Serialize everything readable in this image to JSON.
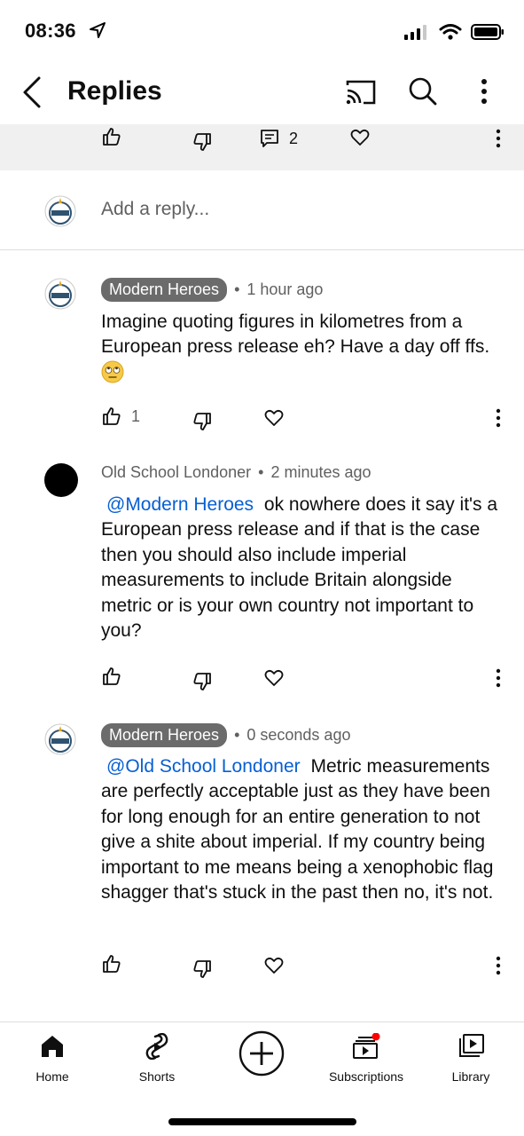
{
  "status": {
    "time": "08:36"
  },
  "header": {
    "title": "Replies"
  },
  "parent": {
    "reply_count": "2"
  },
  "add_reply": {
    "placeholder": "Add a reply..."
  },
  "comments": [
    {
      "author": "Modern Heroes",
      "time": "1 hour ago",
      "text": "Imagine quoting figures in kilometres from a European press release eh? Have a day off ffs.",
      "likes": "1"
    },
    {
      "author": "Old School Londoner",
      "time": "2 minutes ago",
      "mention": "@Modern Heroes",
      "text": "ok nowhere does it say it's a European press release and if that is the case then you should also include imperial measurements to include Britain alongside metric or is your own country not important to you?"
    },
    {
      "author": "Modern Heroes",
      "time": "0 seconds ago",
      "mention": "@Old School Londoner",
      "text": "Metric measurements are perfectly acceptable just as they have been for long enough for an entire generation to not give a shite about imperial. If my country being important to me means being a xenophobic flag shagger that's stuck in the past then no, it's not."
    }
  ],
  "nav": {
    "home": "Home",
    "shorts": "Shorts",
    "subscriptions": "Subscriptions",
    "library": "Library"
  },
  "icons": {
    "like": "thumbs-up-icon",
    "dislike": "thumbs-down-icon",
    "reply": "comment-icon",
    "heart": "heart-icon",
    "more": "more-vertical-icon"
  },
  "colors": {
    "mention": "#065fd4",
    "notification_dot": "#ff0000",
    "badge": "#6b6b6b"
  }
}
